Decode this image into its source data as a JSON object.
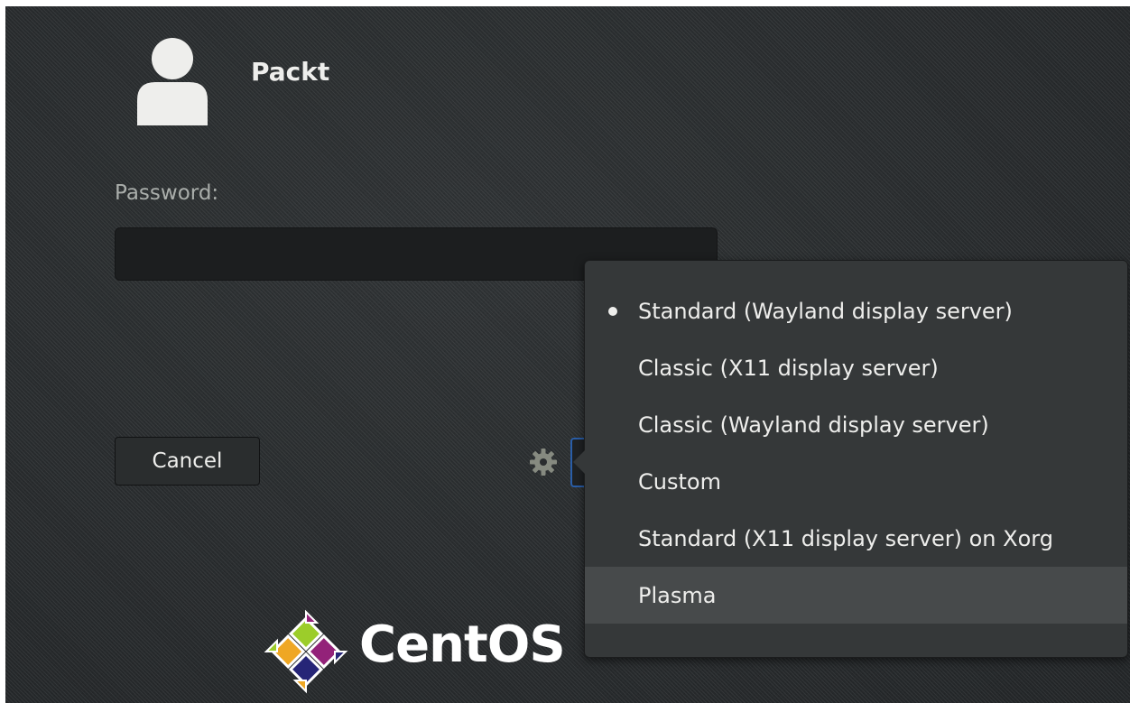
{
  "user": {
    "name": "Packt",
    "icon": "user-avatar-icon"
  },
  "login": {
    "password_label": "Password:",
    "password_value": "",
    "cancel_label": "Cancel"
  },
  "session_menu": {
    "items": [
      {
        "label": "Standard (Wayland display server)",
        "selected": true
      },
      {
        "label": "Classic (X11 display server)",
        "selected": false
      },
      {
        "label": "Classic (Wayland display server)",
        "selected": false
      },
      {
        "label": "Custom",
        "selected": false
      },
      {
        "label": "Standard (X11 display server) on Xorg",
        "selected": false
      },
      {
        "label": "Plasma",
        "selected": false,
        "hovered": true
      }
    ]
  },
  "branding": {
    "wordmark": "CentOS",
    "logo_icon": "centos-logo-icon"
  },
  "colors": {
    "background": "#2a2d2f",
    "menu_background": "#353839",
    "menu_hover": "#474a4b",
    "text": "#eeeeec",
    "focus_border": "#2a5ea8"
  }
}
